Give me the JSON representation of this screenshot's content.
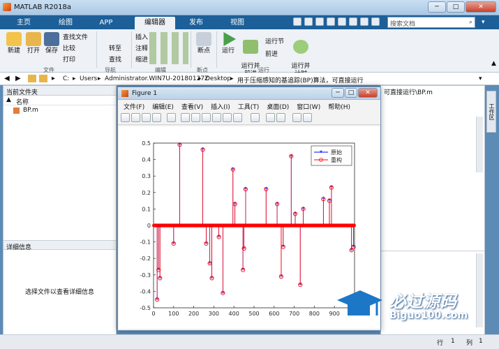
{
  "window": {
    "title": "MATLAB R2018a"
  },
  "tabs": [
    {
      "label": "主页"
    },
    {
      "label": "绘图"
    },
    {
      "label": "APP"
    },
    {
      "label": "编辑器"
    },
    {
      "label": "发布"
    },
    {
      "label": "视图"
    }
  ],
  "search": {
    "placeholder": "搜索文档"
  },
  "ribbon": {
    "file": {
      "new": "新建",
      "open": "打开",
      "save": "保存",
      "find_file": "查找文件",
      "compare": "比较",
      "print": "打印",
      "group": "文件"
    },
    "nav": {
      "goto": "转至",
      "find": "查找",
      "group": "导航"
    },
    "edit": {
      "insert": "插入",
      "comment": "注释",
      "indent": "缩进",
      "group": "编辑"
    },
    "breakpoints": {
      "label": "断点",
      "group": "断点"
    },
    "run": {
      "run": "运行",
      "run_advance": "运行并\n前进",
      "run_section": "运行节",
      "advance": "前进",
      "run_time": "运行并\n计时",
      "group": "运行"
    }
  },
  "address": {
    "path": [
      "C:",
      "Users",
      "Administrator.WIN7U-20180127Z",
      "Desktop",
      "用于压缩感知的基追踪(BP)算法，可直接运行"
    ],
    "suffix": "可直接运行\\BP.m"
  },
  "current_folder": {
    "title": "当前文件夹",
    "col_name": "名称",
    "col_sort": "▲",
    "files": [
      "BP.m"
    ]
  },
  "details": {
    "title": "详细信息",
    "hint": "选择文件以查看详细信息"
  },
  "side_tab": "工作区",
  "status": {
    "row_label": "行",
    "row": "1",
    "col_label": "列",
    "col": "1"
  },
  "figure": {
    "title": "Figure 1",
    "menu": [
      "文件(F)",
      "编辑(E)",
      "查看(V)",
      "插入(I)",
      "工具(T)",
      "桌面(D)",
      "窗口(W)",
      "帮助(H)"
    ]
  },
  "chart_data": {
    "type": "line",
    "xlim": [
      0,
      1000
    ],
    "ylim": [
      -0.5,
      0.5
    ],
    "xticks": [
      "0",
      "100",
      "200",
      "300",
      "400",
      "500",
      "600",
      "700",
      "800",
      "900",
      "1000"
    ],
    "yticks": [
      "-0.5",
      "-0.4",
      "-0.3",
      "-0.2",
      "-0.1",
      "0",
      "0.1",
      "0.2",
      "0.3",
      "0.4",
      "0.5"
    ],
    "legend_position": "top-right",
    "series": [
      {
        "name": "原始",
        "color": "#0000ff",
        "marker": "*",
        "x": [
          18,
          25,
          32,
          100,
          130,
          245,
          262,
          280,
          290,
          325,
          345,
          395,
          405,
          445,
          450,
          458,
          560,
          615,
          635,
          645,
          685,
          705,
          730,
          745,
          845,
          875,
          885,
          985,
          995
        ],
        "y": [
          -0.45,
          -0.27,
          -0.32,
          -0.11,
          0.49,
          0.46,
          -0.11,
          -0.23,
          -0.32,
          -0.07,
          -0.41,
          0.34,
          0.13,
          -0.27,
          -0.14,
          0.22,
          0.22,
          0.13,
          -0.31,
          -0.13,
          0.42,
          0.07,
          -0.36,
          0.1,
          0.16,
          0.15,
          0.23,
          -0.15,
          -0.13
        ]
      },
      {
        "name": "重构",
        "color": "#ff0000",
        "marker": "o",
        "x": [
          18,
          25,
          32,
          100,
          130,
          245,
          262,
          280,
          290,
          325,
          345,
          395,
          405,
          445,
          450,
          458,
          560,
          615,
          635,
          645,
          685,
          705,
          730,
          745,
          845,
          875,
          885,
          985,
          995
        ],
        "y": [
          -0.45,
          -0.27,
          -0.32,
          -0.11,
          0.49,
          0.46,
          -0.11,
          -0.23,
          -0.32,
          -0.07,
          -0.41,
          0.34,
          0.13,
          -0.27,
          -0.14,
          0.22,
          0.22,
          0.13,
          -0.31,
          -0.13,
          0.42,
          0.07,
          -0.36,
          0.1,
          0.16,
          0.15,
          0.23,
          -0.15,
          -0.13
        ]
      }
    ]
  },
  "watermark": {
    "brand": "必过源码",
    "url": "Biguo100.com"
  },
  "colors": {
    "tab_bar": "#1d5f98",
    "ribbon": "#eef1f5",
    "accent_tab": "#eef1f5"
  }
}
